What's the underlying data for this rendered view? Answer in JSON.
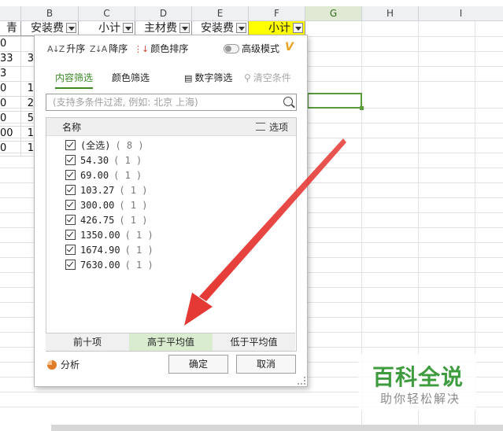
{
  "columns": [
    "B",
    "C",
    "D",
    "E",
    "F",
    "G",
    "H",
    "I"
  ],
  "header_row": [
    {
      "col": "A",
      "text": "青"
    },
    {
      "col": "B",
      "text": "安装费"
    },
    {
      "col": "C",
      "text": "小计"
    },
    {
      "col": "D",
      "text": "主材费"
    },
    {
      "col": "E",
      "text": "安装费"
    },
    {
      "col": "F",
      "text": "小计"
    }
  ],
  "col_a_values": [
    "0",
    "33",
    "3",
    "0",
    "0",
    "0",
    "00",
    "0"
  ],
  "col_b_values": [
    "",
    "3",
    "",
    "1",
    "2",
    "5",
    "1",
    "1"
  ],
  "filter_panel": {
    "sort_asc": "升序",
    "sort_desc": "降序",
    "sort_color": "颜色排序",
    "advanced_mode": "高级模式",
    "tab_content": "内容筛选",
    "tab_color": "颜色筛选",
    "number_filter": "数字筛选",
    "clear_conditions": "清空条件",
    "search_placeholder": "(支持多条件过滤, 例如: 北京 上海)",
    "list_header_name": "名称",
    "list_header_options": "选项",
    "items": [
      {
        "label": "(全选)",
        "count": "( 8 )"
      },
      {
        "label": "54.30",
        "count": "( 1 )"
      },
      {
        "label": "69.00",
        "count": "( 1 )"
      },
      {
        "label": "103.27",
        "count": "( 1 )"
      },
      {
        "label": "300.00",
        "count": "( 1 )"
      },
      {
        "label": "426.75",
        "count": "( 1 )"
      },
      {
        "label": "1350.00",
        "count": "( 1 )"
      },
      {
        "label": "1674.90",
        "count": "( 1 )"
      },
      {
        "label": "7630.00",
        "count": "( 1 )"
      }
    ],
    "bottom_tabs": [
      "前十项",
      "高于平均值",
      "低于平均值"
    ],
    "analyze": "分析",
    "ok": "确定",
    "cancel": "取消"
  },
  "watermark": {
    "title": "百科全说",
    "subtitle": "助你轻松解决"
  },
  "colors": {
    "accent_green": "#3a8a24",
    "highlight_yellow": "#ffff00",
    "arrow_red": "#e53935"
  }
}
